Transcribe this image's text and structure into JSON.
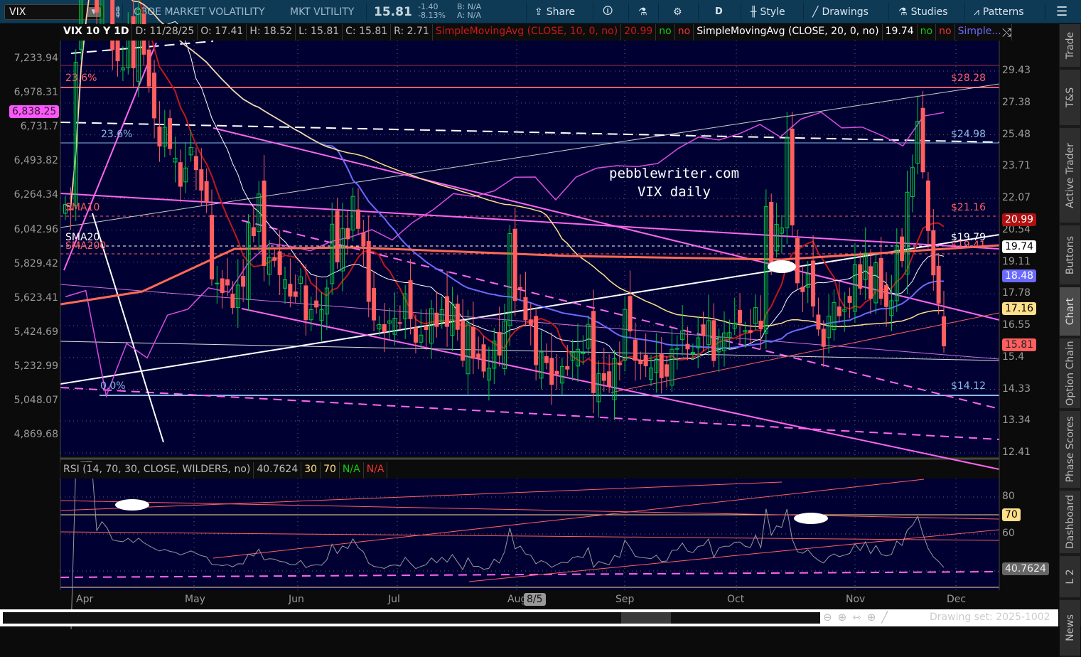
{
  "toolbar": {
    "symbol": "VIX",
    "company": "CBOE MARKET VOLATILITY",
    "short_name": "MKT VLTILITY",
    "last": "15.81",
    "change": "-1.40",
    "change_pct": "-8.13%",
    "bid": "B: N/A",
    "ask": "A: N/A",
    "share": "Share",
    "period": "D",
    "style": "Style",
    "drawings": "Drawings",
    "studies": "Studies",
    "patterns": "Patterns"
  },
  "header": {
    "title": "VIX 10 Y 1D",
    "date": "D: 11/28/25",
    "open": "O: 17.41",
    "high": "H: 18.52",
    "low": "L: 15.81",
    "close": "C: 15.81",
    "range": "R: 2.71",
    "sma10": "SimpleMovingAvg (CLOSE, 10, 0, no)",
    "sma10_val": "20.99",
    "no": "no",
    "sma20": "SimpleMovingAvg (CLOSE, 20, 0, no)",
    "sma20_val": "19.74",
    "more": "Simple..."
  },
  "rsi_header": {
    "label": "RSI (14, 70, 30, CLOSE, WILDERS, no)",
    "value": "40.7624",
    "ob": "30",
    "os": "70",
    "na1": "N/A",
    "na2": "N/A"
  },
  "watermark": {
    "line1": "pebblewriter.com",
    "line2": "VIX daily"
  },
  "annotations": {
    "fib1": "23.6%",
    "fib2": "23.6%",
    "fib3": "0.0%",
    "sma10": "SMA10",
    "sma20": "SMA20",
    "sma200": "SMA200",
    "lvl1": "$28.28",
    "lvl2": "$24.98",
    "lvl3": "$21.16",
    "lvl4": "$19.79",
    "lvl5": "$19.41",
    "lvl6": "$14.12"
  },
  "right_axis": [
    "29.43",
    "27.38",
    "25.48",
    "23.71",
    "22.07",
    "20.54",
    "19.11",
    "17.78",
    "16.55",
    "15.4",
    "14.33",
    "13.34",
    "12.41"
  ],
  "left_axis": [
    "7,233.94",
    "6,978.31",
    "6,731.7",
    "6,493.82",
    "6,264.34",
    "6,042.96",
    "5,829.42",
    "5,623.41",
    "5,424.69",
    "5,232.99",
    "5,048.07",
    "4,869.68"
  ],
  "badges": {
    "sma10": "20.99",
    "sma20": "19.74",
    "blue": "18.48",
    "yellow": "17.16",
    "last": "15.81",
    "spx": "6,838.25",
    "rsi": "40.7624",
    "rsi70": "70"
  },
  "rsi_axis": [
    "80",
    "60",
    "40"
  ],
  "x_axis": [
    "Apr",
    "May",
    "Jun",
    "Jul",
    "Aug",
    "Sep",
    "Oct",
    "Nov",
    "Dec"
  ],
  "x_marker": "8/5",
  "sidebar": [
    "Trade",
    "T&S",
    "Active Trader",
    "Buttons",
    "Chart",
    "Option Chain",
    "Phase Scores",
    "Dashboard",
    "L 2",
    "News"
  ],
  "footer": {
    "drawing_set": "Drawing set: 2025-1002"
  },
  "colors": {
    "up": "#00c83c",
    "down": "#ff5f5f",
    "bg": "#000033",
    "spx": "#d94ce0"
  },
  "chart_data": {
    "type": "candlestick",
    "title": "VIX 10 Y 1D",
    "scale": "log",
    "ylim": [
      12.41,
      29.43
    ],
    "closes": [
      21.77,
      21.51,
      30.02,
      45.31,
      46.98,
      52.33,
      33.62,
      40.72,
      37.56,
      30.89,
      30.12,
      29.65,
      32.64,
      29.65,
      33.82,
      30.57,
      28.45,
      26.47,
      24.84,
      25.92,
      24.7,
      24.17,
      22.68,
      23.64,
      24.76,
      23.55,
      22.48,
      21.9,
      18.39,
      18.22,
      17.83,
      18.14,
      17.24,
      18.14,
      18.09,
      20.87,
      20.28,
      22.29,
      18.96,
      19.31,
      19.18,
      18.57,
      18.36,
      17.69,
      17.68,
      18.48,
      16.77,
      17.16,
      17.26,
      17.16,
      18.02,
      20.82,
      19.11,
      20.62,
      20.14,
      22.17,
      20.62,
      19.83,
      17.48,
      16.76,
      16.59,
      16.32,
      16.73,
      16.83,
      16.64,
      17.79,
      16.81,
      15.94,
      16.2,
      16.4,
      17.2,
      16.52,
      17.16,
      16.52,
      17.38,
      16.41,
      15.3,
      16.65,
      15.37,
      15.39,
      14.93,
      15.03,
      15.98,
      15.48,
      16.72,
      20.38,
      17.52,
      18.0,
      16.77,
      16.57,
      15.15,
      15.59,
      15.22,
      14.49,
      14.83,
      15.09,
      15.0,
      15.57,
      15.69,
      15.57,
      16.6,
      14.22,
      14.85,
      14.62,
      14.43,
      15.36,
      15.15,
      17.17,
      16.35,
      15.3,
      15.18,
      15.11,
      15.04,
      15.35,
      14.71,
      14.76,
      15.69,
      15.72,
      16.36,
      15.7,
      15.58,
      16.1,
      16.18,
      16.74,
      15.29,
      16.12,
      16.28,
      16.29,
      16.63,
      16.65,
      16.37,
      16.3,
      17.24,
      16.43,
      21.66,
      19.03,
      20.81,
      20.64,
      25.31,
      20.78,
      18.23,
      17.87,
      18.6,
      17.3,
      16.42,
      15.79,
      16.91,
      17.44,
      16.92,
      17.17,
      17.44,
      19.0,
      18.01,
      19.5,
      17.6,
      19.08,
      17.6,
      17.28,
      17.51,
      19.83,
      19.17,
      22.38,
      23.66,
      26.27,
      23.43,
      20.52,
      18.56,
      17.41,
      15.81
    ],
    "spx": [
      5633,
      5670,
      5074,
      5363,
      5282,
      5525,
      5560,
      5686,
      5660,
      5844,
      5958,
      5940,
      5912,
      5970,
      6000,
      6045,
      5980,
      6092,
      6173,
      6279,
      6259,
      6297,
      6388,
      6389,
      6238,
      6389,
      6449,
      6466,
      6460,
      6481,
      6584,
      6664,
      6643,
      6688,
      6753,
      6664,
      6791,
      6840,
      6728,
      6734,
      6672,
      6602,
      6812,
      6838
    ],
    "spx_ylim": [
      4869.68,
      7233.94
    ],
    "rsi_ylim": [
      30,
      90
    ]
  }
}
